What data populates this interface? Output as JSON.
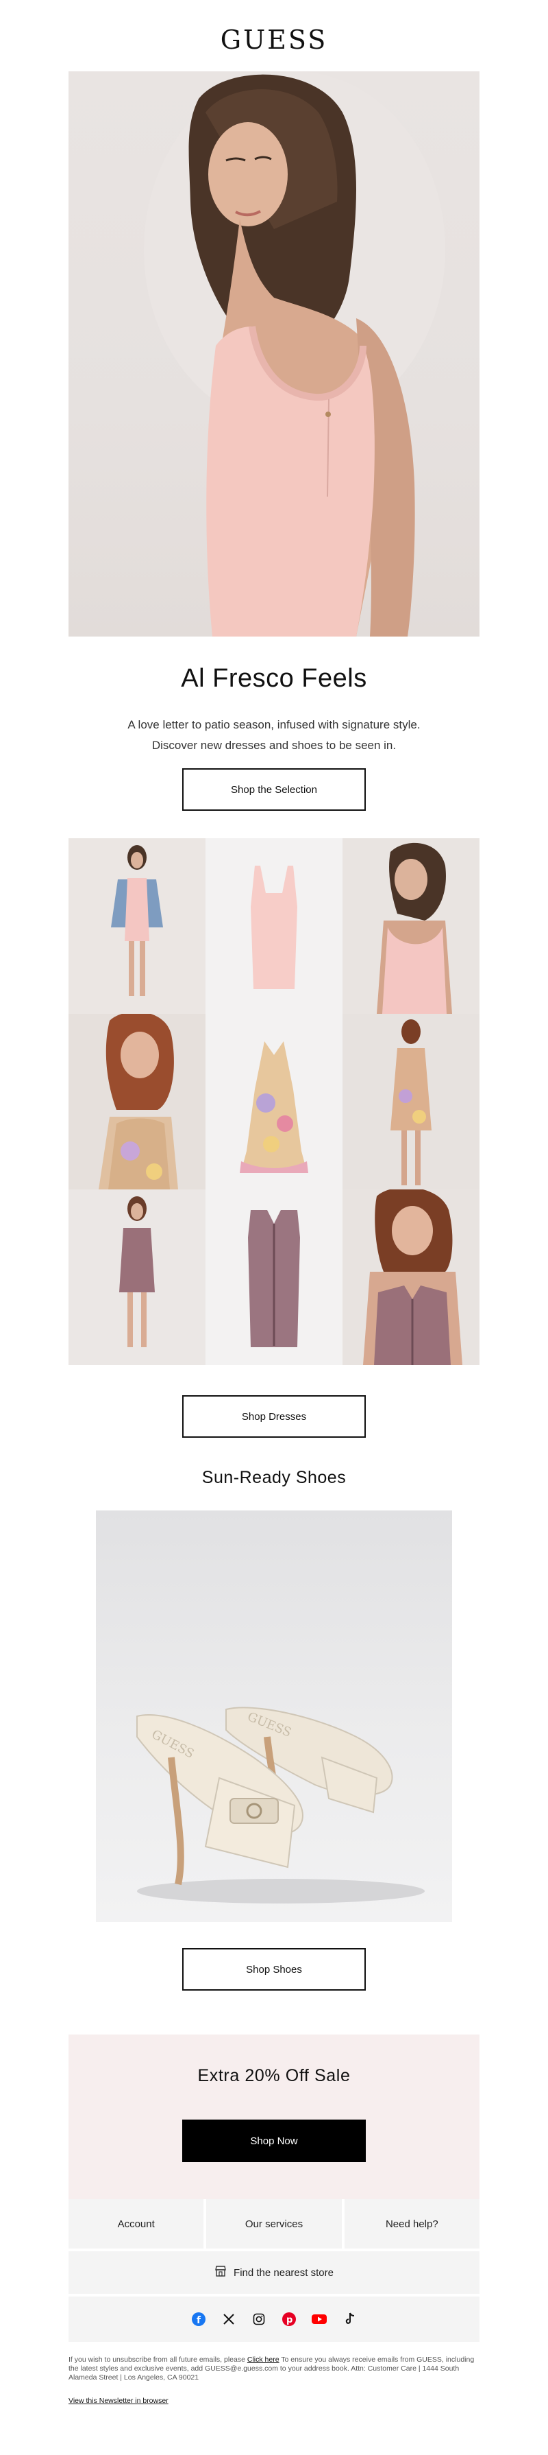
{
  "brand": {
    "logo_text": "GUESS"
  },
  "hero": {
    "image": "woman-in-pink-knit-dress",
    "title": "Al Fresco Feels",
    "body_line1": "A love letter to patio season, infused with signature style.",
    "body_line2": "Discover new dresses and shoes to be seen in.",
    "cta": "Shop the Selection"
  },
  "dress_grid": {
    "tiles": [
      "pink-dress-denim-jacket-model",
      "pink-knit-dress-product",
      "pink-dress-back-view",
      "floral-halter-dress-model",
      "floral-halter-dress-product",
      "floral-dress-back-view",
      "mauve-zip-dress-model",
      "mauve-zip-dress-product",
      "mauve-zip-dress-closeup"
    ],
    "cta": "Shop Dresses"
  },
  "shoes": {
    "title": "Sun-Ready Shoes",
    "image": "cream-logo-mule-heels",
    "cta": "Shop Shoes"
  },
  "promo": {
    "title": "Extra 20% Off Sale",
    "cta": "Shop Now"
  },
  "footer_links": [
    "Account",
    "Our services",
    "Need help?"
  ],
  "store_link": "Find the nearest store",
  "social_icons": [
    "facebook-icon",
    "x-icon",
    "instagram-icon",
    "pinterest-icon",
    "youtube-icon",
    "tiktok-icon"
  ],
  "colors": {
    "facebook": "#1877f2",
    "pinterest": "#e60023",
    "youtube": "#ff0000",
    "promo_bg": "#f7eeee"
  },
  "legal": {
    "pre": "If you wish to unsubscribe from all future emails, please",
    "link": "Click here",
    "post": "To ensure you always receive emails from GUESS, including the latest styles and exclusive events, add GUESS@e.guess.com to your address book. Attn: Customer Care | 1444 South Alameda Street | Los Angeles, CA 90021",
    "view_in_browser": "View this Newsletter in browser"
  }
}
